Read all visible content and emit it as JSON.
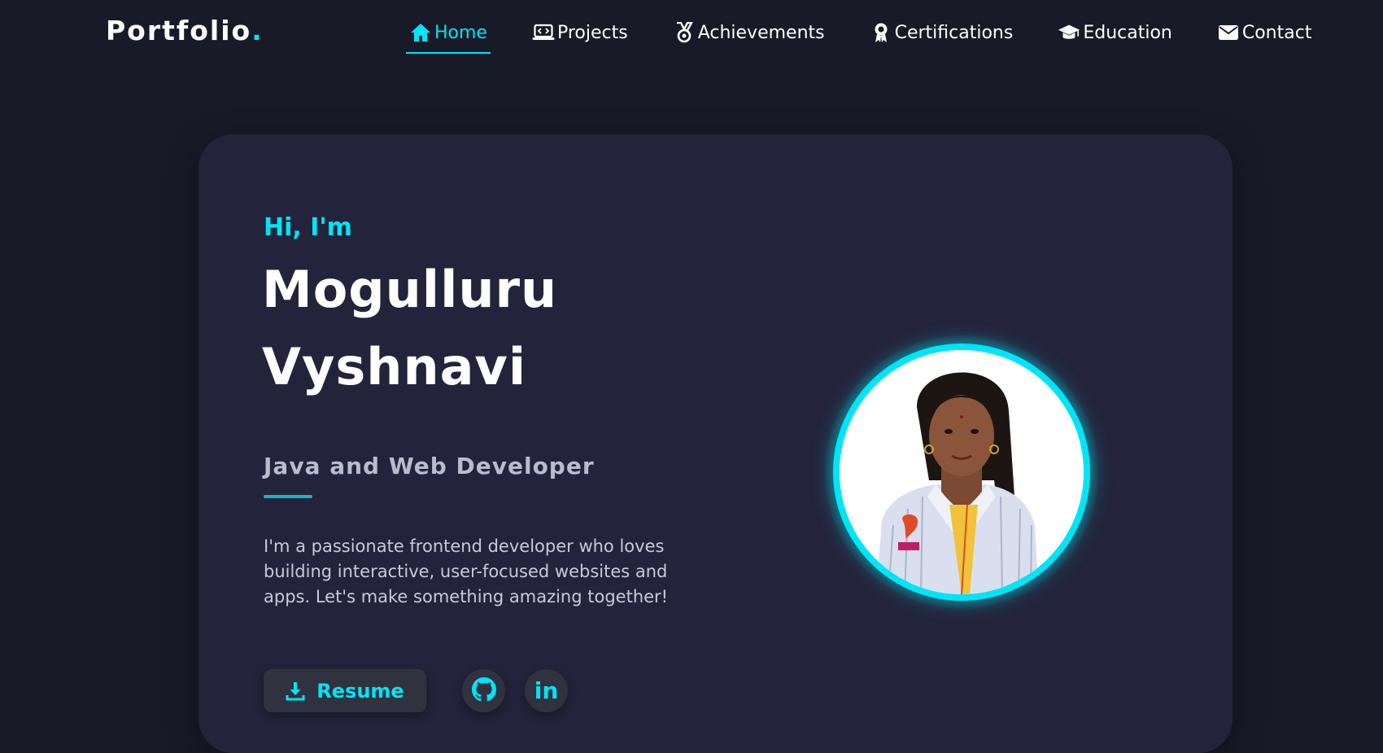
{
  "logo": {
    "text": "Portfolio",
    "dot": "."
  },
  "nav": {
    "items": [
      {
        "label": "Home",
        "icon": "home-icon",
        "active": true
      },
      {
        "label": "Projects",
        "icon": "laptop-code-icon",
        "active": false
      },
      {
        "label": "Achievements",
        "icon": "medal-icon",
        "active": false
      },
      {
        "label": "Certifications",
        "icon": "award-ribbon-icon",
        "active": false
      },
      {
        "label": "Education",
        "icon": "graduation-cap-icon",
        "active": false
      },
      {
        "label": "Contact",
        "icon": "envelope-icon",
        "active": false
      }
    ]
  },
  "hero": {
    "greeting": "Hi, I'm",
    "name_first": "Mogulluru",
    "name_last": "Vyshnavi",
    "role": "Java and Web Developer",
    "description": "I'm a passionate frontend developer who loves building interactive, user-focused websites and apps. Let's make something amazing together!",
    "resume_label": "Resume",
    "linkedin_label": "in"
  },
  "colors": {
    "accent": "#00e5f5",
    "background": "#191a28",
    "card": "#23243b",
    "button": "#30323f"
  }
}
